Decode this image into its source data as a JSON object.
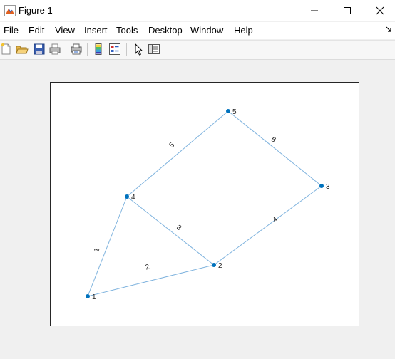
{
  "window": {
    "title": "Figure 1",
    "icon": "matlab-figure-icon",
    "controls": [
      "minimize-icon",
      "maximize-icon",
      "close-icon"
    ]
  },
  "menu": {
    "items": [
      "File",
      "Edit",
      "View",
      "Insert",
      "Tools",
      "Desktop",
      "Window",
      "Help"
    ]
  },
  "toolbar": {
    "buttons": [
      "new-figure-icon",
      "open-file-icon",
      "save-icon",
      "print-icon",
      "print-preview-icon",
      "insert-colorbar-icon",
      "insert-legend-icon",
      "edit-plot-arrow-icon",
      "property-inspector-icon"
    ]
  },
  "graph": {
    "colors": {
      "edge": "#7fb3de",
      "node": "#0072bd",
      "text": "#262626"
    },
    "nodes": [
      {
        "id": "1",
        "label": "1"
      },
      {
        "id": "2",
        "label": "2"
      },
      {
        "id": "3",
        "label": "3"
      },
      {
        "id": "4",
        "label": "4"
      },
      {
        "id": "5",
        "label": "5"
      }
    ],
    "edges": [
      {
        "from": "1",
        "to": "4",
        "label": "1"
      },
      {
        "from": "1",
        "to": "2",
        "label": "2"
      },
      {
        "from": "4",
        "to": "2",
        "label": "3"
      },
      {
        "from": "2",
        "to": "3",
        "label": "4"
      },
      {
        "from": "4",
        "to": "5",
        "label": "5"
      },
      {
        "from": "5",
        "to": "3",
        "label": "6"
      }
    ]
  }
}
